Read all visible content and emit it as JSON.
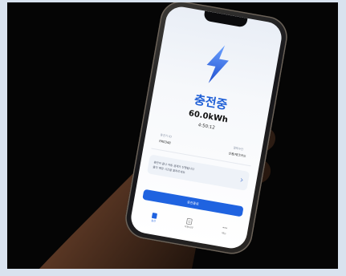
{
  "screen": {
    "status_title": "충전중",
    "energy": "60.0kWh",
    "elapsed_time": "4:50:12",
    "stats": [
      {
        "label": "충전기 ID",
        "value": "PR0348"
      },
      {
        "label": "결제수단",
        "value": "신용/체크카드"
      }
    ],
    "info_card": {
      "line1": "충전이 끝나 자동 결제가 진행됩니다",
      "line2": "출차 예정 시간을 알려주세요"
    },
    "primary_button": "충전종료",
    "tabs": [
      {
        "label": "충전",
        "icon": "charge-icon",
        "active": true
      },
      {
        "label": "이용내역",
        "icon": "history-icon",
        "active": false
      },
      {
        "label": "메뉴",
        "icon": "menu-icon",
        "active": false
      }
    ]
  },
  "colors": {
    "accent": "#1f63e0",
    "background": "#050505",
    "border": "#d9e3ef"
  }
}
